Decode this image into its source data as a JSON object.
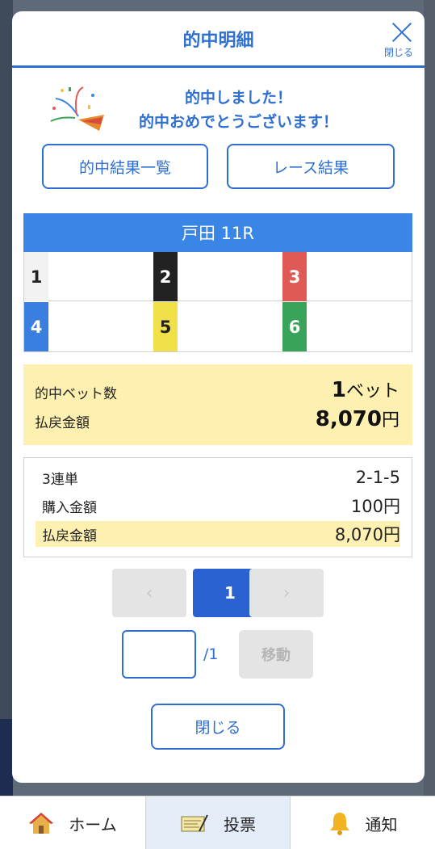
{
  "modal": {
    "title": "的中明細",
    "close_label": "閉じる",
    "message_line1": "的中しました！",
    "message_line2": "的中おめでとうございます！"
  },
  "actions": {
    "results_list": "的中結果一覧",
    "race_results": "レース結果"
  },
  "race": {
    "title": "戸田 11R",
    "entries": [
      {
        "num": "1",
        "bg": "#f2f2f2",
        "fg": "#222222"
      },
      {
        "num": "2",
        "bg": "#222222",
        "fg": "#ffffff"
      },
      {
        "num": "3",
        "bg": "#e05a55",
        "fg": "#ffffff"
      },
      {
        "num": "4",
        "bg": "#3a7fe0",
        "fg": "#ffffff"
      },
      {
        "num": "5",
        "bg": "#f2e04a",
        "fg": "#222222"
      },
      {
        "num": "6",
        "bg": "#3aa35a",
        "fg": "#ffffff"
      }
    ]
  },
  "summary": {
    "bet_count_label": "的中ベット数",
    "bet_count_value": "1",
    "bet_count_unit": "ベット",
    "payout_label": "払戻金額",
    "payout_value": "8,070",
    "payout_unit": "円"
  },
  "detail": {
    "type_label": "3連単",
    "type_value": "2-1-5",
    "purchase_label": "購入金額",
    "purchase_value": "100円",
    "payout_label": "払戻金額",
    "payout_value": "8,070円"
  },
  "pagination": {
    "prev": "‹",
    "current": "1",
    "next": "›",
    "total": "/1",
    "move_label": "移動",
    "input_value": ""
  },
  "footer_button": "閉じる",
  "tabbar": {
    "home": "ホーム",
    "vote": "投票",
    "notify": "通知"
  },
  "colors": {
    "accent": "#2f6fd0",
    "race_header": "#3a86e6",
    "highlight": "#fdf0b0"
  }
}
